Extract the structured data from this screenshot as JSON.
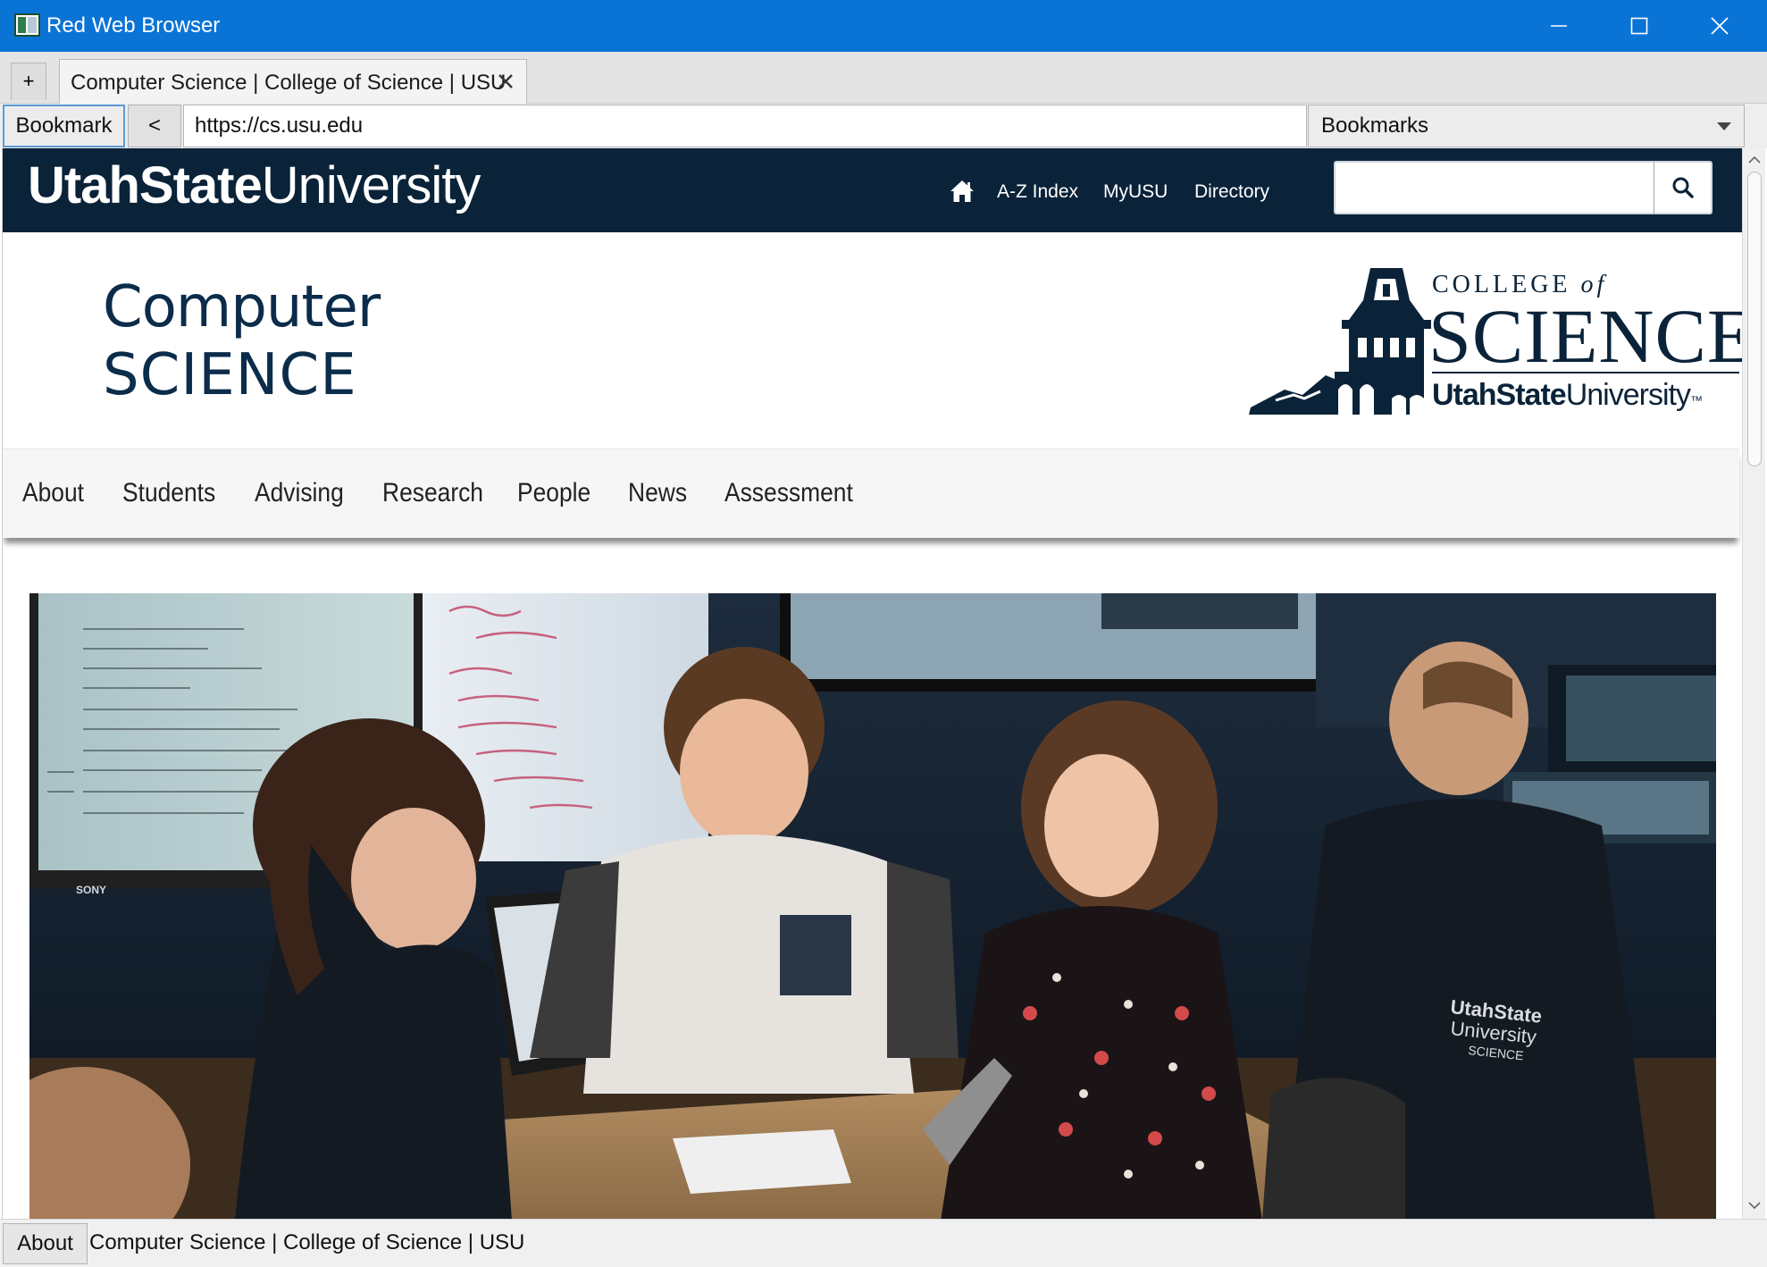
{
  "window": {
    "title": "Red Web Browser"
  },
  "tabs": {
    "new_tab_label": "+",
    "items": [
      {
        "label": "Computer Science | College of Science | USU"
      }
    ]
  },
  "toolbar": {
    "bookmark_label": "Bookmark",
    "back_label": "<",
    "url": "https://cs.usu.edu",
    "bookmarks_select": "Bookmarks"
  },
  "page": {
    "header": {
      "wordmark_bold": "UtahState",
      "wordmark_light": "University",
      "nav": [
        "A-Z Index",
        "MyUSU",
        "Directory"
      ],
      "search_value": "",
      "brand_color": "#0b2339"
    },
    "department": {
      "line1": "Computer",
      "line2": "SCIENCE"
    },
    "college_logo": {
      "college": "COLLEGE",
      "of": "of",
      "science": "SCIENCE",
      "usu_bold": "UtahState",
      "usu_light": "University",
      "tm": "™"
    },
    "main_nav": [
      "About",
      "Students",
      "Advising",
      "Research",
      "People",
      "News",
      "Assessment"
    ],
    "hero": {
      "sweatshirt_text": [
        "UtahState",
        "University",
        "SCIENCE"
      ],
      "monitor_brand": "SONY"
    }
  },
  "statusbar": {
    "about_label": "About",
    "text": "Computer Science | College of Science | USU"
  },
  "icons": {
    "home": "home-icon",
    "search": "search-icon",
    "close_tab": "close-icon",
    "minimize": "minimize-icon",
    "maximize": "maximize-icon",
    "close_window": "close-window-icon",
    "dropdown": "chevron-down-icon"
  }
}
